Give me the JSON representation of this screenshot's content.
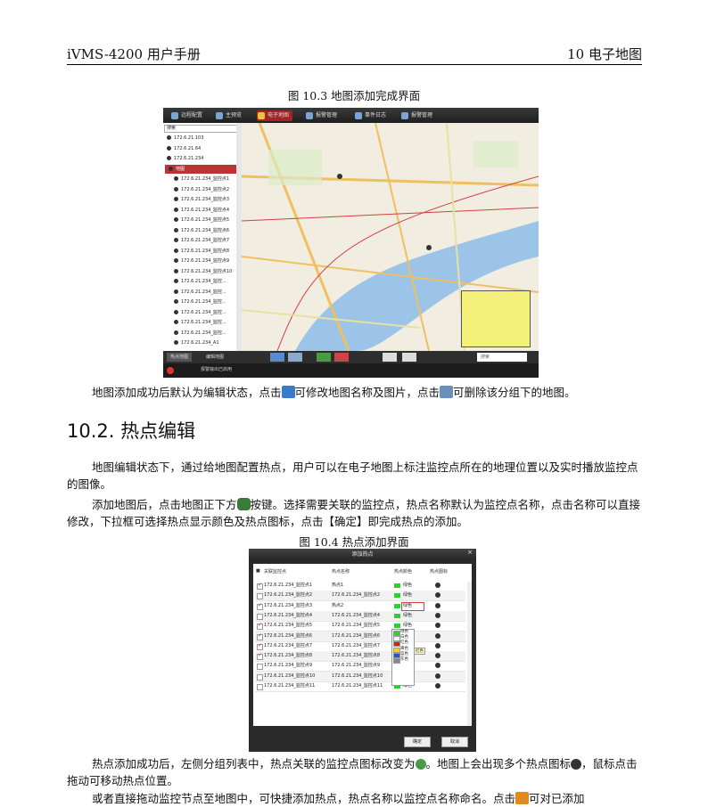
{
  "header": {
    "left": "iVMS-4200  用户手册",
    "right": "10  电子地图"
  },
  "fig1_caption": "图  10.3  地图添加完成界面",
  "para1": {
    "before1": "地图添加成功后默认为编辑状态，点击",
    "after1": "可修改地图名称及图片，点击",
    "after2": "可删除该分组下的地图。"
  },
  "section_title": "10.2. 热点编辑",
  "para2": "地图编辑状态下，通过给地图配置热点，用户可以在电子地图上标注监控点所在的地理位置以及实时播放监控点的图像。",
  "para3": {
    "before": "添加地图后，点击地图正下方",
    "after": "按键。选择需要关联的监控点，热点名称默认为监控点名称，点击名称可以直接修改，下拉框可选择热点显示颜色及热点图标，点击【确定】即完成热点的添加。"
  },
  "fig2_caption": "图  10.4  热点添加界面",
  "para4": {
    "before": "热点添加成功后，左侧分组列表中，热点关联的监控点图标改变为",
    "mid": "。地图上会出现多个热点图标",
    "after": "，鼠标点击拖动可移动热点位置。"
  },
  "para5_partial": "或者直接拖动监控节点至地图中，可快捷添加热点，热点名称以监控点名称命名。点击",
  "para5_tail": "可对已添加",
  "screen": {
    "tabs": [
      "远程配置",
      "主预览",
      "电子地图",
      "报警管理",
      "事件日志",
      "报警管理"
    ],
    "search_placeholder": "搜索",
    "tree": [
      "172.6.21.103",
      "172.6.21.64",
      "172.6.21.234",
      "地图",
      "172.6.21.234_监控点1",
      "172.6.21.234_监控点2",
      "172.6.21.234_监控点3",
      "172.6.21.234_监控点4",
      "172.6.21.234_监控点5",
      "172.6.21.234_监控点6",
      "172.6.21.234_监控点7",
      "172.6.21.234_监控点8",
      "172.6.21.234_监控点9",
      "172.6.21.234_监控点10",
      "172.6.21.234_监控...",
      "172.6.21.234_监控...",
      "172.6.21.234_监控...",
      "172.6.21.234_监控...",
      "172.6.21.234_监控...",
      "172.6.21.234_监控...",
      "172.6.21.234_A1"
    ],
    "bottom_tabs": [
      "热点地图",
      "编辑地图"
    ],
    "map_search": "搜索",
    "status_text": "报警输出已启用"
  },
  "dialog": {
    "title": "添加热点",
    "columns": [
      "关联监控点",
      "热点名称",
      "热点颜色",
      "热点图标"
    ],
    "rows": [
      {
        "cam": "172.6.21.234_监控点1",
        "name": "热点1",
        "color": "绿色",
        "checked": true
      },
      {
        "cam": "172.6.21.234_监控点2",
        "name": "172.6.21.234_监控点2",
        "color": "绿色",
        "checked": false
      },
      {
        "cam": "172.6.21.234_监控点3",
        "name": "热点2",
        "color": "绿色",
        "checked": true
      },
      {
        "cam": "172.6.21.234_监控点4",
        "name": "172.6.21.234_监控点4",
        "color": "绿色",
        "checked": false
      },
      {
        "cam": "172.6.21.234_监控点5",
        "name": "172.6.21.234_监控点5",
        "color": "绿色",
        "checked": true
      },
      {
        "cam": "172.6.21.234_监控点6",
        "name": "172.6.21.234_监控点6",
        "color": "绿色",
        "checked": true
      },
      {
        "cam": "172.6.21.234_监控点7",
        "name": "172.6.21.234_监控点7",
        "color": "绿色",
        "checked": true
      },
      {
        "cam": "172.6.21.234_监控点8",
        "name": "172.6.21.234_监控点8",
        "color": "绿色",
        "checked": true
      },
      {
        "cam": "172.6.21.234_监控点9",
        "name": "172.6.21.234_监控点9",
        "color": "绿色",
        "checked": false
      },
      {
        "cam": "172.6.21.234_监控点10",
        "name": "172.6.21.234_监控点10",
        "color": "绿色",
        "checked": false
      },
      {
        "cam": "172.6.21.234_监控点11",
        "name": "172.6.21.234_监控点11",
        "color": "绿色",
        "checked": false
      }
    ],
    "dropdown_options": [
      "绿色",
      "白色",
      "红色",
      "黄色",
      "蓝色",
      "灰色"
    ],
    "dropdown_colors": [
      "#33cc33",
      "#ffffff",
      "#cc2222",
      "#e8d820",
      "#2255cc",
      "#888888"
    ],
    "tooltip": "红色",
    "ok": "确定",
    "cancel": "取消"
  }
}
